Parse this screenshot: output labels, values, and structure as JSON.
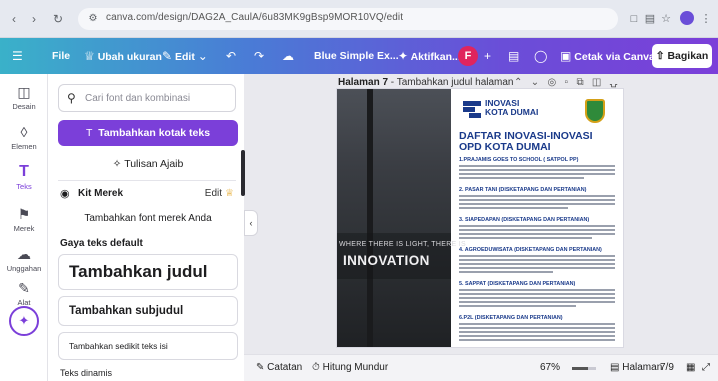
{
  "browser": {
    "url": "canva.com/design/DAG2A_CaulA/6u83MK9gBsp9MOR10VQ/edit"
  },
  "toolbar": {
    "file": "File",
    "resize": "Ubah ukuran",
    "edit": "Edit",
    "title": "Blue Simple Ex...",
    "activate": "Aktifkan...",
    "avatar_letter": "F",
    "print": "Cetak via Canva",
    "share": "Bagikan"
  },
  "rail": {
    "items": [
      {
        "label": "Desain",
        "icon": "layout-icon"
      },
      {
        "label": "Elemen",
        "icon": "shapes-icon"
      },
      {
        "label": "Teks",
        "icon": "text-icon"
      },
      {
        "label": "Merek",
        "icon": "brand-icon"
      },
      {
        "label": "Unggahan",
        "icon": "upload-icon"
      },
      {
        "label": "Alat",
        "icon": "draw-icon"
      }
    ]
  },
  "panel": {
    "search_placeholder": "Cari font dan kombinasi",
    "add_textbox": "Tambahkan kotak teks",
    "magic_write": "Tulisan Ajaib",
    "brand_kit": "Kit Merek",
    "brand_edit": "Edit",
    "brand_font": "Tambahkan font merek Anda",
    "default_styles": "Gaya teks default",
    "heading": "Tambahkan judul",
    "subheading": "Tambahkan subjudul",
    "body": "Tambahkan sedikit teks isi",
    "dynamic": "Teks dinamis"
  },
  "canvas": {
    "page_label": "Halaman 7",
    "page_title": "Tambahkan judul halaman",
    "doc": {
      "photo_text_small": "WHERE THERE IS LIGHT, THERE IS",
      "photo_text_big": "INNOVATION",
      "logo_line1": "INOVASI",
      "logo_line2": "KOTA DUMAI",
      "title_line1": "DAFTAR INOVASI-INOVASI",
      "title_line2": "OPD KOTA DUMAI",
      "items": [
        "1.PRAJAMIS GOES TO SCHOOL ( SATPOL PP)",
        "2. PASAR TANI (DISKETAPANG DAN PERTANIAN)",
        "3. SIAPEDAPAN (DISKETAPANG DAN PERTANIAN)",
        "4. AGROEDUWISATA (DISKETAPANG DAN PERTANIAN)",
        "5. SAPPAT (DISKETAPANG DAN PERTANIAN)",
        "6.P2L (DISKETAPANG DAN PERTANIAN)"
      ]
    }
  },
  "statusbar": {
    "notes": "Catatan",
    "timer": "Hitung Mundur",
    "zoom": "67%",
    "zoom_fraction": 0.67,
    "pages": "Halaman",
    "page_count": "7/9"
  },
  "colors": {
    "accent": "#7b3fd9",
    "brand_blue": "#1a3a8a"
  }
}
